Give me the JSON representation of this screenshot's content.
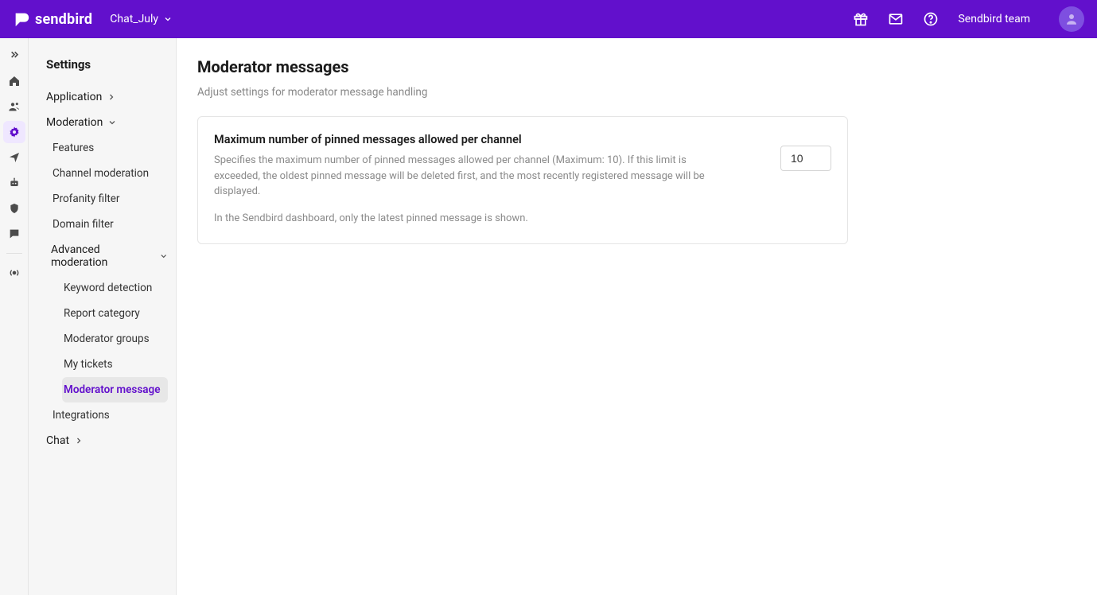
{
  "header": {
    "brand": "sendbird",
    "app_name": "Chat_July",
    "team": "Sendbird team"
  },
  "sidebar": {
    "title": "Settings",
    "groups": {
      "application": "Application",
      "moderation": "Moderation",
      "chat": "Chat"
    },
    "moderation_items": {
      "features": "Features",
      "channel_moderation": "Channel moderation",
      "profanity_filter": "Profanity filter",
      "domain_filter": "Domain filter",
      "advanced_moderation": "Advanced moderation",
      "keyword_detection": "Keyword detection",
      "report_category": "Report category",
      "moderator_groups": "Moderator groups",
      "my_tickets": "My tickets",
      "moderator_message": "Moderator message",
      "integrations": "Integrations"
    }
  },
  "main": {
    "title": "Moderator messages",
    "subtitle": "Adjust settings for moderator message handling",
    "card": {
      "title": "Maximum number of pinned messages allowed per channel",
      "desc": "Specifies the maximum number of pinned messages allowed per channel (Maximum: 10). If this limit is exceeded, the oldest pinned message will be deleted first, and the most recently registered message will be displayed.",
      "note": "In the Sendbird dashboard, only the latest pinned message is shown.",
      "value": "10"
    }
  }
}
